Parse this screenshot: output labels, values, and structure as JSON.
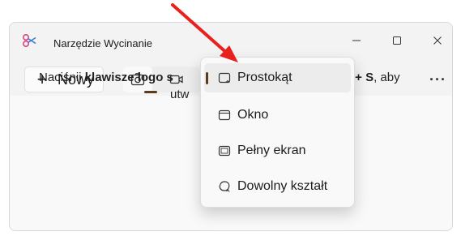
{
  "window": {
    "title": "Narzędzie Wycinanie",
    "minimize_icon": "minimize-icon",
    "maximize_icon": "maximize-icon",
    "close_icon": "close-icon"
  },
  "toolbar": {
    "new_label": "Nowy",
    "new_icon": "plus-icon",
    "photo_mode_icon": "camera-icon",
    "video_mode_icon": "video-camera-icon",
    "more_label": "···"
  },
  "instructions": {
    "line1_prefix": "Naciśnij ",
    "line1_bold": "klawisze logo s",
    "line1_right_bold": "ft + S",
    "line1_right_suffix": ", aby",
    "line2": "utw"
  },
  "dropdown": {
    "items": [
      {
        "label": "Prostokąt",
        "icon": "rectangle-snip-icon",
        "selected": true
      },
      {
        "label": "Okno",
        "icon": "window-snip-icon",
        "selected": false
      },
      {
        "label": "Pełny ekran",
        "icon": "fullscreen-snip-icon",
        "selected": false
      },
      {
        "label": "Dowolny kształt",
        "icon": "freeform-snip-icon",
        "selected": false
      }
    ]
  },
  "colors": {
    "accent": "#5c3a1e",
    "arrow": "#e8211c",
    "window_bg": "#f3f3f3",
    "menu_bg": "#f9f9f9"
  }
}
